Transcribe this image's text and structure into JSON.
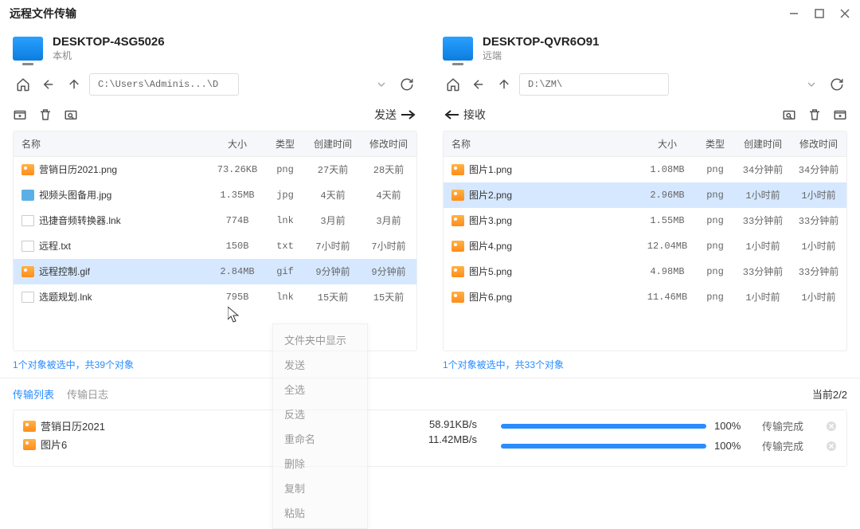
{
  "window": {
    "title": "远程文件传输"
  },
  "local": {
    "host": "DESKTOP-4SG5026",
    "role": "本机",
    "path": "C:\\Users\\Adminis...\\Desktop\\",
    "send_label": "发送",
    "columns": {
      "name": "名称",
      "size": "大小",
      "type": "类型",
      "ctime": "创建时间",
      "mtime": "修改时间"
    },
    "rows": [
      {
        "icon": "img",
        "name": "营销日历2021.png",
        "size": "73.26KB",
        "type": "png",
        "ctime": "27天前",
        "mtime": "28天前",
        "selected": false
      },
      {
        "icon": "jpg",
        "name": "视频头图备用.jpg",
        "size": "1.35MB",
        "type": "jpg",
        "ctime": "4天前",
        "mtime": "4天前",
        "selected": false
      },
      {
        "icon": "lnk",
        "name": "迅捷音频转换器.lnk",
        "size": "774B",
        "type": "lnk",
        "ctime": "3月前",
        "mtime": "3月前",
        "selected": false
      },
      {
        "icon": "txt",
        "name": "远程.txt",
        "size": "150B",
        "type": "txt",
        "ctime": "7小时前",
        "mtime": "7小时前",
        "selected": false
      },
      {
        "icon": "img",
        "name": "远程控制.gif",
        "size": "2.84MB",
        "type": "gif",
        "ctime": "9分钟前",
        "mtime": "9分钟前",
        "selected": true
      },
      {
        "icon": "lnk",
        "name": "选题规划.lnk",
        "size": "795B",
        "type": "lnk",
        "ctime": "15天前",
        "mtime": "15天前",
        "selected": false
      }
    ],
    "status": "1个对象被选中，共39个对象"
  },
  "remote": {
    "host": "DESKTOP-QVR6O91",
    "role": "远端",
    "path": "D:\\ZM\\",
    "recv_label": "接收",
    "columns": {
      "name": "名称",
      "size": "大小",
      "type": "类型",
      "ctime": "创建时间",
      "mtime": "修改时间"
    },
    "rows": [
      {
        "icon": "img",
        "name": "图片1.png",
        "size": "1.08MB",
        "type": "png",
        "ctime": "34分钟前",
        "mtime": "34分钟前",
        "selected": false
      },
      {
        "icon": "img",
        "name": "图片2.png",
        "size": "2.96MB",
        "type": "png",
        "ctime": "1小时前",
        "mtime": "1小时前",
        "selected": true
      },
      {
        "icon": "img",
        "name": "图片3.png",
        "size": "1.55MB",
        "type": "png",
        "ctime": "33分钟前",
        "mtime": "33分钟前",
        "selected": false
      },
      {
        "icon": "img",
        "name": "图片4.png",
        "size": "12.04MB",
        "type": "png",
        "ctime": "1小时前",
        "mtime": "1小时前",
        "selected": false
      },
      {
        "icon": "img",
        "name": "图片5.png",
        "size": "4.98MB",
        "type": "png",
        "ctime": "33分钟前",
        "mtime": "33分钟前",
        "selected": false
      },
      {
        "icon": "img",
        "name": "图片6.png",
        "size": "11.46MB",
        "type": "png",
        "ctime": "1小时前",
        "mtime": "1小时前",
        "selected": false
      }
    ],
    "status": "1个对象被选中，共33个对象"
  },
  "context_menu": {
    "items": [
      "文件夹中显示",
      "发送",
      "全选",
      "反选",
      "重命名",
      "删除",
      "复制",
      "粘贴"
    ]
  },
  "bottom": {
    "tabs": {
      "list": "传输列表",
      "log": "传输日志"
    },
    "counter": "当前2/2",
    "transfers": [
      {
        "icon": "img",
        "name": "营销日历2021",
        "speed": "58.91KB/s",
        "pct": "100%",
        "status": "传输完成"
      },
      {
        "icon": "img",
        "name": "图片6",
        "speed": "11.42MB/s",
        "pct": "100%",
        "status": "传输完成"
      }
    ]
  }
}
